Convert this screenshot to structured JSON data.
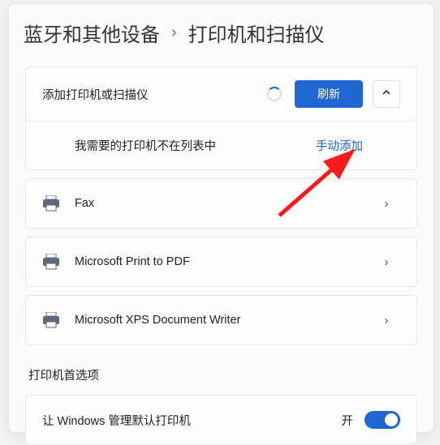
{
  "breadcrumb": {
    "parent": "蓝牙和其他设备",
    "current": "打印机和扫描仪"
  },
  "addSection": {
    "title": "添加打印机或扫描仪",
    "refresh_label": "刷新",
    "not_in_list_label": "我需要的打印机不在列表中",
    "manual_add_label": "手动添加"
  },
  "printers": [
    {
      "name": "Fax"
    },
    {
      "name": "Microsoft Print to PDF"
    },
    {
      "name": "Microsoft XPS Document Writer"
    }
  ],
  "prefs": {
    "section_title": "打印机首选项",
    "manage_default_label": "让 Windows 管理默认打印机",
    "manage_default_state": "开"
  },
  "colors": {
    "accent": "#1f66d0",
    "link": "#1967c7"
  }
}
